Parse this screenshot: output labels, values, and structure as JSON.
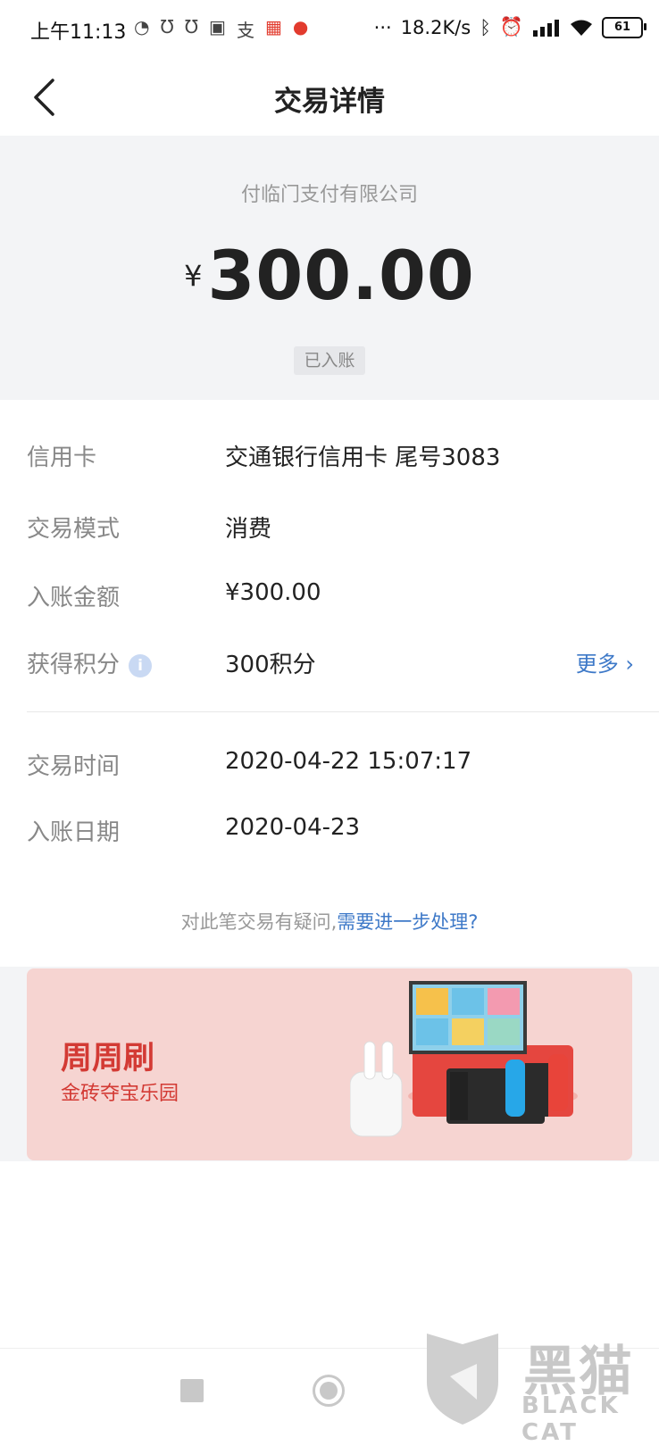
{
  "status_bar": {
    "time": "上午11:13",
    "net_speed": "18.2K/s",
    "battery": "61"
  },
  "header": {
    "title": "交易详情"
  },
  "summary": {
    "merchant": "付临门支付有限公司",
    "currency_symbol": "¥",
    "amount": "300.00",
    "status": "已入账"
  },
  "details": {
    "card": {
      "label": "信用卡",
      "value": "交通银行信用卡 尾号3083"
    },
    "mode": {
      "label": "交易模式",
      "value": "消费"
    },
    "posted_amount": {
      "label": "入账金额",
      "value": "¥300.00"
    },
    "points": {
      "label": "获得积分",
      "value": "300积分",
      "more": "更多 ›"
    },
    "trans_time": {
      "label": "交易时间",
      "value": "2020-04-22 15:07:17"
    },
    "post_date": {
      "label": "入账日期",
      "value": "2020-04-23"
    }
  },
  "help": {
    "question": "对此笔交易有疑问,",
    "link": "需要进一步处理?"
  },
  "banner": {
    "title": "周周刷",
    "subtitle": "金砖夺宝乐园"
  },
  "watermark": {
    "cn": "黑猫",
    "en": "BLACK CAT"
  },
  "colors": {
    "accent": "#3e79c8",
    "banner_bg": "#f6d4d1",
    "banner_text": "#d33a34",
    "hero_bg": "#f3f4f6"
  }
}
